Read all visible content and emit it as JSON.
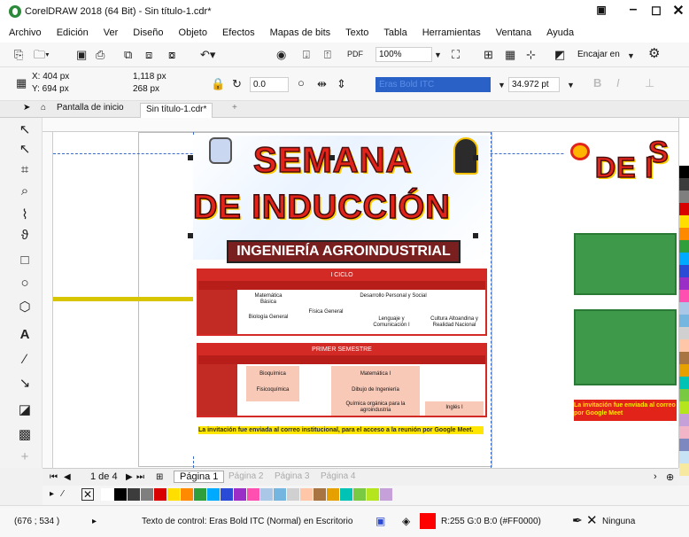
{
  "window": {
    "title": "CorelDRAW 2018 (64 Bit) - Sin título-1.cdr*"
  },
  "menu": [
    "Archivo",
    "Edición",
    "Ver",
    "Diseño",
    "Objeto",
    "Efectos",
    "Mapas de bits",
    "Texto",
    "Tabla",
    "Herramientas",
    "Ventana",
    "Ayuda"
  ],
  "toolbar": {
    "zoom": "100%",
    "snap_label": "Encajar en"
  },
  "props": {
    "x": "X: 404 px",
    "y": "Y: 694 px",
    "w": "1,118 px",
    "h": "268 px",
    "angle": "0.0",
    "font": "Eras Bold ITC",
    "size": "34.972 pt"
  },
  "tabs": {
    "home": "Pantalla de inicio",
    "doc": "Sin título-1.cdr*"
  },
  "poster": {
    "title1": "SEMANA",
    "title2": "DE INDUCCIÓN",
    "band": "INGENIERÍA AGROINDUSTRIAL",
    "t1_header": "I CICLO",
    "t1_cells": [
      "Matemática Básica",
      "Física General",
      "Desarrollo Personal y Social",
      "Biología General",
      "Lenguaje y Comunicación I",
      "Cultura Altoandina y Realidad Nacional"
    ],
    "t2_header": "PRIMER SEMESTRE",
    "t2_cells": [
      "Bioquímica",
      "Matemática I",
      "Fisicoquímica",
      "Dibujo de Ingeniería",
      "Química orgánica para la agroindustria",
      "Inglés I"
    ],
    "note": "La invitación fue enviada al correo institucional, para el acceso a la reunión por Google Meet."
  },
  "right_poster": {
    "title": "DE I",
    "title_top": "S",
    "note": "La invitación fue enviada al correo por Google Meet"
  },
  "pagebar": {
    "count": "1 de 4",
    "pages": [
      "Página 1",
      "Página 2",
      "Página 3",
      "Página 4"
    ]
  },
  "status": {
    "coords": "(676 ; 534 )",
    "text": "Texto de control: Eras Bold ITC (Normal) en Escritorio",
    "fill": "R:255 G:0 B:0 (#FF0000)",
    "outline": "Ninguna"
  },
  "colors": {
    "accent_red": "#e2231a",
    "status_red": "#ff0000"
  },
  "palette": [
    "#ffffff",
    "#000000",
    "#3c3c3c",
    "#7f7f7f",
    "#d90000",
    "#ffde00",
    "#ff8a00",
    "#2e9f3a",
    "#00aaff",
    "#2a4bd6",
    "#9b2ec6",
    "#ff4fb0",
    "#aac7e8",
    "#74b6e0",
    "#d0d0d0",
    "#ffc6a8",
    "#a87442",
    "#e6a000",
    "#00c2b5",
    "#7ac943",
    "#b5e61d",
    "#c6a0d8",
    "#f2b5c8",
    "#7e88c0",
    "#c7e2f5",
    "#f7e9a0"
  ]
}
